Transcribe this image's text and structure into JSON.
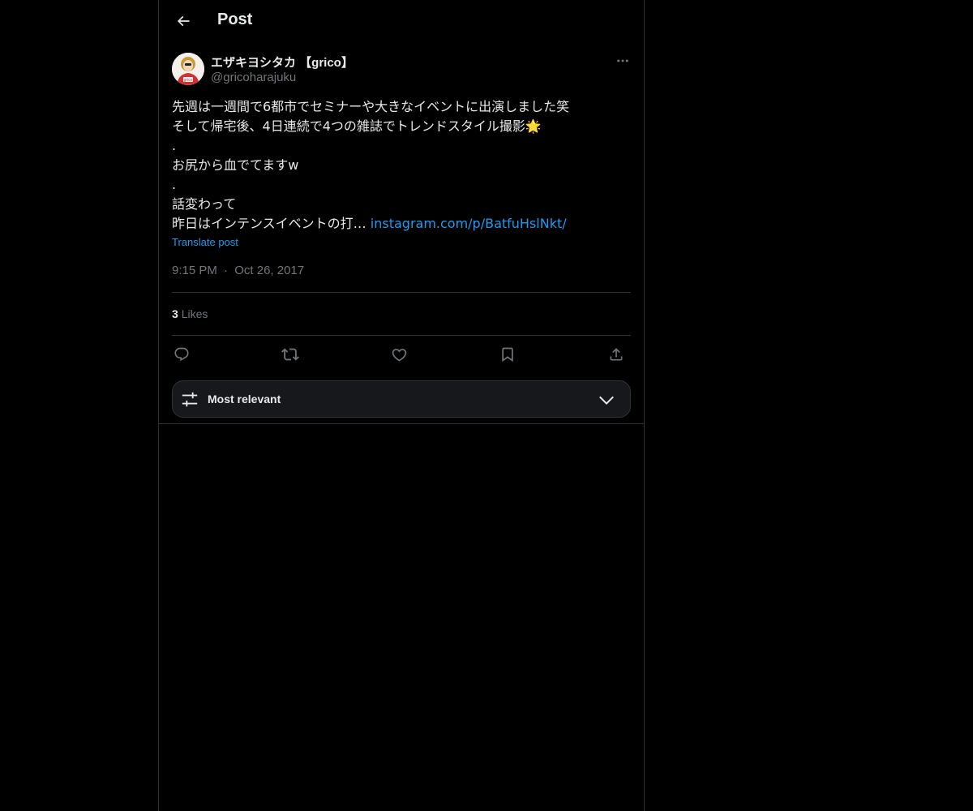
{
  "header": {
    "title": "Post",
    "back_icon": "arrow-left-icon"
  },
  "author": {
    "display_name": "エザキヨシタカ 【grico】",
    "handle": "@gricoharajuku",
    "avatar_label": "grico",
    "more_icon": "more-horizontal-icon"
  },
  "post": {
    "lines": [
      "先週は一週間で6都市でセミナーや大きなイベントに出演しました笑",
      "そして帰宅後、4日連続で4つの雑誌でトレンドスタイル撮影🌟",
      ".",
      "お尻から血でてますw",
      ".",
      "話変わって"
    ],
    "last_line_text": "昨日はインテンスイベントの打… ",
    "link": "instagram.com/p/BatfuHslNkt/",
    "translate_label": "Translate post",
    "time": "9:15 PM",
    "separator": "·",
    "date": "Oct 26, 2017"
  },
  "stats": {
    "likes_count": "3",
    "likes_label": "Likes"
  },
  "actions": {
    "reply_icon": "reply-icon",
    "repost_icon": "repost-icon",
    "like_icon": "heart-icon",
    "bookmark_icon": "bookmark-icon",
    "share_icon": "share-icon"
  },
  "sort": {
    "label": "Most relevant",
    "icon": "sliders-icon",
    "chevron": "chevron-down-icon"
  },
  "colors": {
    "background": "#000000",
    "text": "#e7e9ea",
    "muted": "#71767b",
    "accent": "#1d9bf0",
    "border": "#2f3336"
  }
}
